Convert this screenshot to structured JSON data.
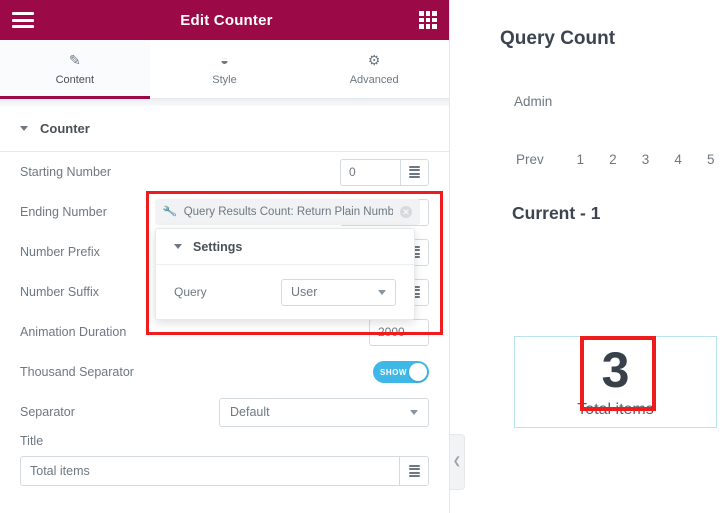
{
  "panel": {
    "header": {
      "title": "Edit Counter",
      "menu_icon": "hamburger-icon",
      "apps_icon": "grid-apps-icon"
    },
    "tabs": [
      {
        "label": "Content",
        "icon": "pencil-icon",
        "active": true
      },
      {
        "label": "Style",
        "icon": "half-circle-icon",
        "active": false
      },
      {
        "label": "Advanced",
        "icon": "gear-icon",
        "active": false
      }
    ],
    "section": {
      "title": "Counter"
    },
    "controls": [
      {
        "label": "Starting Number",
        "value": "0",
        "type": "number"
      },
      {
        "label": "Ending Number",
        "value": "",
        "type": "number"
      },
      {
        "label": "Number Prefix",
        "value": "",
        "type": "number"
      },
      {
        "label": "Number Suffix",
        "value": "",
        "type": "number"
      },
      {
        "label": "Animation Duration",
        "value": "2000",
        "type": "number"
      },
      {
        "label": "Thousand Separator",
        "value": "SHOW",
        "type": "switch"
      },
      {
        "label": "Separator",
        "value": "Default",
        "type": "select"
      }
    ],
    "title_field": {
      "label": "Title",
      "value": "Total items"
    },
    "dynamic_tag": {
      "icon": "wrench-icon",
      "text": "Query Results Count: Return Plain Number",
      "remove_icon": "remove-circle-icon",
      "popover": {
        "section_title": "Settings",
        "query_label": "Query",
        "query_value": "User"
      }
    }
  },
  "preview": {
    "heading": "Query Count",
    "user_row": "Admin",
    "pagination": [
      "Prev",
      "1",
      "2",
      "3",
      "4",
      "5"
    ],
    "current": "Current - 1",
    "widget": {
      "number": "3",
      "title": "Total items"
    },
    "collapse_icon": "chevron-left-icon"
  },
  "colors": {
    "header_bg": "#9b0a46",
    "accent": "#9b0a46",
    "switch_on": "#3fb8e8",
    "annotation": "#ee1c1c",
    "widget_border": "#b9e2ee"
  }
}
